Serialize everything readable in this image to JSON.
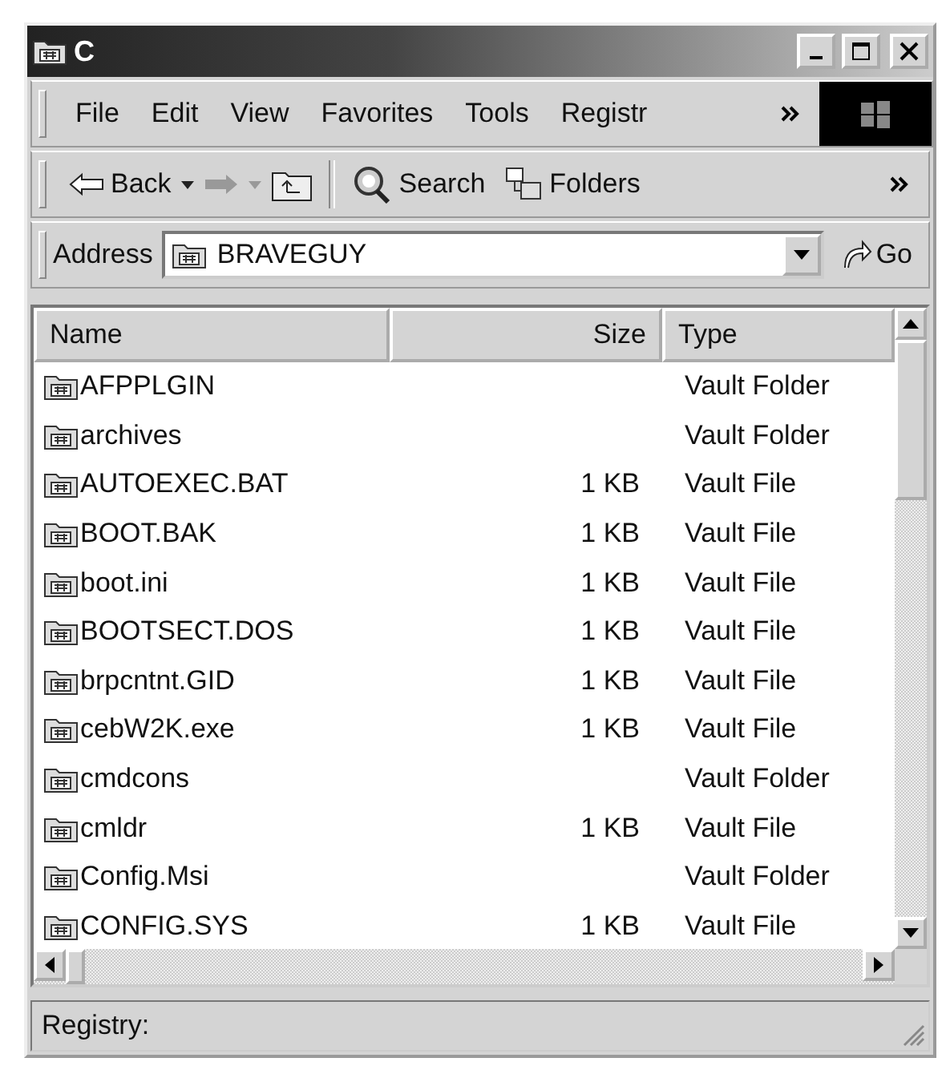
{
  "window": {
    "title": "C"
  },
  "menu": [
    "File",
    "Edit",
    "View",
    "Favorites",
    "Tools",
    "Registr"
  ],
  "toolbar": [
    {
      "kind": "back",
      "label": "Back",
      "disabled": false
    },
    {
      "kind": "forward",
      "disabled": true
    },
    {
      "kind": "up",
      "disabled": false
    },
    {
      "kind": "search",
      "label": "Search",
      "disabled": false
    },
    {
      "kind": "folders",
      "label": "Folders",
      "disabled": false
    }
  ],
  "address": {
    "label": "Address",
    "value": "BRAVEGUY",
    "go": "Go"
  },
  "table": {
    "columns": [
      "Name",
      "Size",
      "Type"
    ],
    "rows": [
      {
        "name": "AFPPLGIN",
        "size": "",
        "type": "Vault Folder"
      },
      {
        "name": "archives",
        "size": "",
        "type": "Vault Folder"
      },
      {
        "name": "AUTOEXEC.BAT",
        "size": "1 KB",
        "type": "Vault File"
      },
      {
        "name": "BOOT.BAK",
        "size": "1 KB",
        "type": "Vault File"
      },
      {
        "name": "boot.ini",
        "size": "1 KB",
        "type": "Vault File"
      },
      {
        "name": "BOOTSECT.DOS",
        "size": "1 KB",
        "type": "Vault File"
      },
      {
        "name": "brpcntnt.GID",
        "size": "1 KB",
        "type": "Vault File"
      },
      {
        "name": "cebW2K.exe",
        "size": "1 KB",
        "type": "Vault File"
      },
      {
        "name": "cmdcons",
        "size": "",
        "type": "Vault Folder"
      },
      {
        "name": "cmldr",
        "size": "1 KB",
        "type": "Vault File"
      },
      {
        "name": "Config.Msi",
        "size": "",
        "type": "Vault Folder"
      },
      {
        "name": "CONFIG.SYS",
        "size": "1 KB",
        "type": "Vault File"
      }
    ]
  },
  "status_bar": "Registry:"
}
